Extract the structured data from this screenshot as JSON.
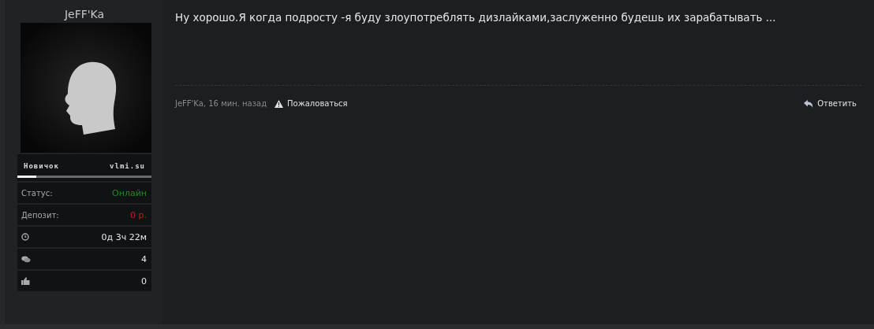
{
  "author": {
    "name": "JeFF'Ka",
    "rank": {
      "title": "Новичок",
      "site": "vlmi.su",
      "level": 0.14
    },
    "stats": [
      {
        "kind": "label",
        "label": "Статус:",
        "value": "Онлайн",
        "color": "#1f8a1f"
      },
      {
        "kind": "label",
        "label": "Депозит:",
        "value": "0 р.",
        "color": "#c81c1c"
      },
      {
        "kind": "clock",
        "value": "0д 3ч 22м"
      },
      {
        "kind": "messages",
        "value": "4"
      },
      {
        "kind": "likes",
        "value": "0"
      }
    ]
  },
  "post": {
    "text": "Ну хорошо.Я когда подросту -я буду злоупотреблять дизлайками,заслуженно будешь их зарабатывать ...",
    "meta": "JeFF'Ka, 16 мин. назад",
    "report": "Пожаловаться",
    "reply": "Ответить"
  }
}
